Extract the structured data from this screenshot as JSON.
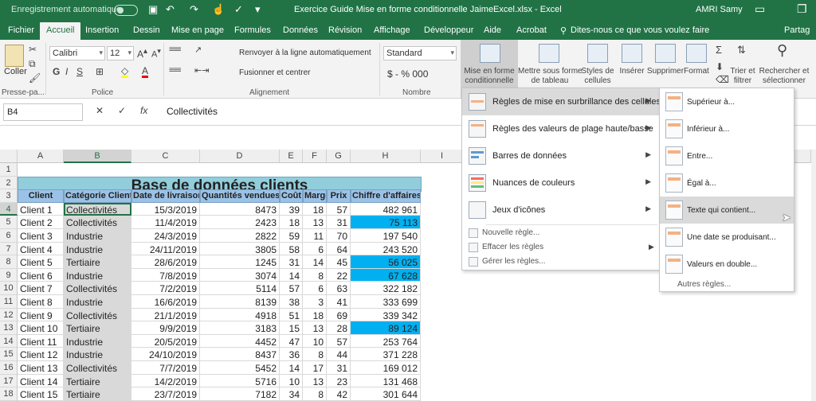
{
  "titlebar": {
    "autosave": "Enregistrement automatique",
    "title": "Exercice Guide Mise en forme conditionnelle JaimeExcel.xlsx  -  Excel",
    "user": "AMRI Samy"
  },
  "tabs": [
    "Fichier",
    "Accueil",
    "Insertion",
    "Dessin",
    "Mise en page",
    "Formules",
    "Données",
    "Révision",
    "Affichage",
    "Développeur",
    "Aide",
    "Acrobat",
    "Dites-nous ce que vous voulez faire",
    "Partag"
  ],
  "ribbon": {
    "paste": "Coller",
    "clipboard_group": "Presse-pa...",
    "font_name": "Calibri",
    "font_size": "12",
    "font_group": "Police",
    "wrap": "Renvoyer à la ligne automatiquement",
    "merge": "Fusionner et centrer",
    "align_group": "Alignement",
    "number_format": "Standard",
    "number_group": "Nombre",
    "currency": "$ - % 000",
    "mef1": "Mise en forme",
    "mef2": "conditionnelle",
    "tbl1": "Mettre sous forme",
    "tbl2": "de tableau",
    "styles1": "Styles de",
    "styles2": "cellules",
    "insert": "Insérer",
    "delete": "Supprimer",
    "format": "Format",
    "sort1": "Trier et",
    "sort2": "filtrer",
    "find1": "Rechercher et",
    "find2": "sélectionner"
  },
  "formula": {
    "namebox": "B4",
    "content": "Collectivités"
  },
  "sheet": {
    "columns": [
      "A",
      "B",
      "C",
      "D",
      "E",
      "F",
      "G",
      "H",
      "I"
    ],
    "rows": [
      "1",
      "2",
      "3",
      "4",
      "5",
      "6",
      "7",
      "8",
      "9",
      "10",
      "11",
      "12",
      "13",
      "14",
      "15",
      "16",
      "17",
      "18"
    ],
    "banner": "Base de données clients",
    "headers": [
      "Client",
      "Catégorie Client",
      "Date de livraison",
      "Quantités vendues",
      "Coût",
      "Marge",
      "Prix",
      "Chiffre d'affaires"
    ],
    "data": [
      [
        "Client 1",
        "Collectivités",
        "15/3/2019",
        "8473",
        "39",
        "18",
        "57",
        "482 961"
      ],
      [
        "Client 2",
        "Collectivités",
        "11/4/2019",
        "2423",
        "18",
        "13",
        "31",
        "75 113"
      ],
      [
        "Client 3",
        "Industrie",
        "24/3/2019",
        "2822",
        "59",
        "11",
        "70",
        "197 540"
      ],
      [
        "Client 4",
        "Industrie",
        "24/11/2019",
        "3805",
        "58",
        "6",
        "64",
        "243 520"
      ],
      [
        "Client 5",
        "Tertiaire",
        "28/6/2019",
        "1245",
        "31",
        "14",
        "45",
        "56 025"
      ],
      [
        "Client 6",
        "Industrie",
        "7/8/2019",
        "3074",
        "14",
        "8",
        "22",
        "67 628"
      ],
      [
        "Client 7",
        "Collectivités",
        "7/2/2019",
        "5114",
        "57",
        "6",
        "63",
        "322 182"
      ],
      [
        "Client 8",
        "Industrie",
        "16/6/2019",
        "8139",
        "38",
        "3",
        "41",
        "333 699"
      ],
      [
        "Client 9",
        "Collectivités",
        "21/1/2019",
        "4918",
        "51",
        "18",
        "69",
        "339 342"
      ],
      [
        "Client 10",
        "Tertiaire",
        "9/9/2019",
        "3183",
        "15",
        "13",
        "28",
        "89 124"
      ],
      [
        "Client 11",
        "Industrie",
        "20/5/2019",
        "4452",
        "47",
        "10",
        "57",
        "253 764"
      ],
      [
        "Client 12",
        "Industrie",
        "24/10/2019",
        "8437",
        "36",
        "8",
        "44",
        "371 228"
      ],
      [
        "Client 13",
        "Collectivités",
        "7/7/2019",
        "5452",
        "14",
        "17",
        "31",
        "169 012"
      ],
      [
        "Client 14",
        "Tertiaire",
        "14/2/2019",
        "5716",
        "10",
        "13",
        "23",
        "131 468"
      ],
      [
        "Client 15",
        "Tertiaire",
        "23/7/2019",
        "7182",
        "34",
        "8",
        "42",
        "301 644"
      ]
    ],
    "highlight_color": "#00b0f0"
  },
  "menu": {
    "items": [
      "Règles de mise en surbrillance des cellules",
      "Règles des valeurs de plage haute/basse",
      "Barres de données",
      "Nuances de couleurs",
      "Jeux d'icônes"
    ],
    "small": [
      "Nouvelle règle...",
      "Effacer les règles",
      "Gérer les règles..."
    ]
  },
  "submenu": {
    "items": [
      "Supérieur à...",
      "Inférieur à...",
      "Entre...",
      "Égal à...",
      "Texte qui contient...",
      "Une date se produisant...",
      "Valeurs en double..."
    ],
    "other": "Autres règles..."
  }
}
